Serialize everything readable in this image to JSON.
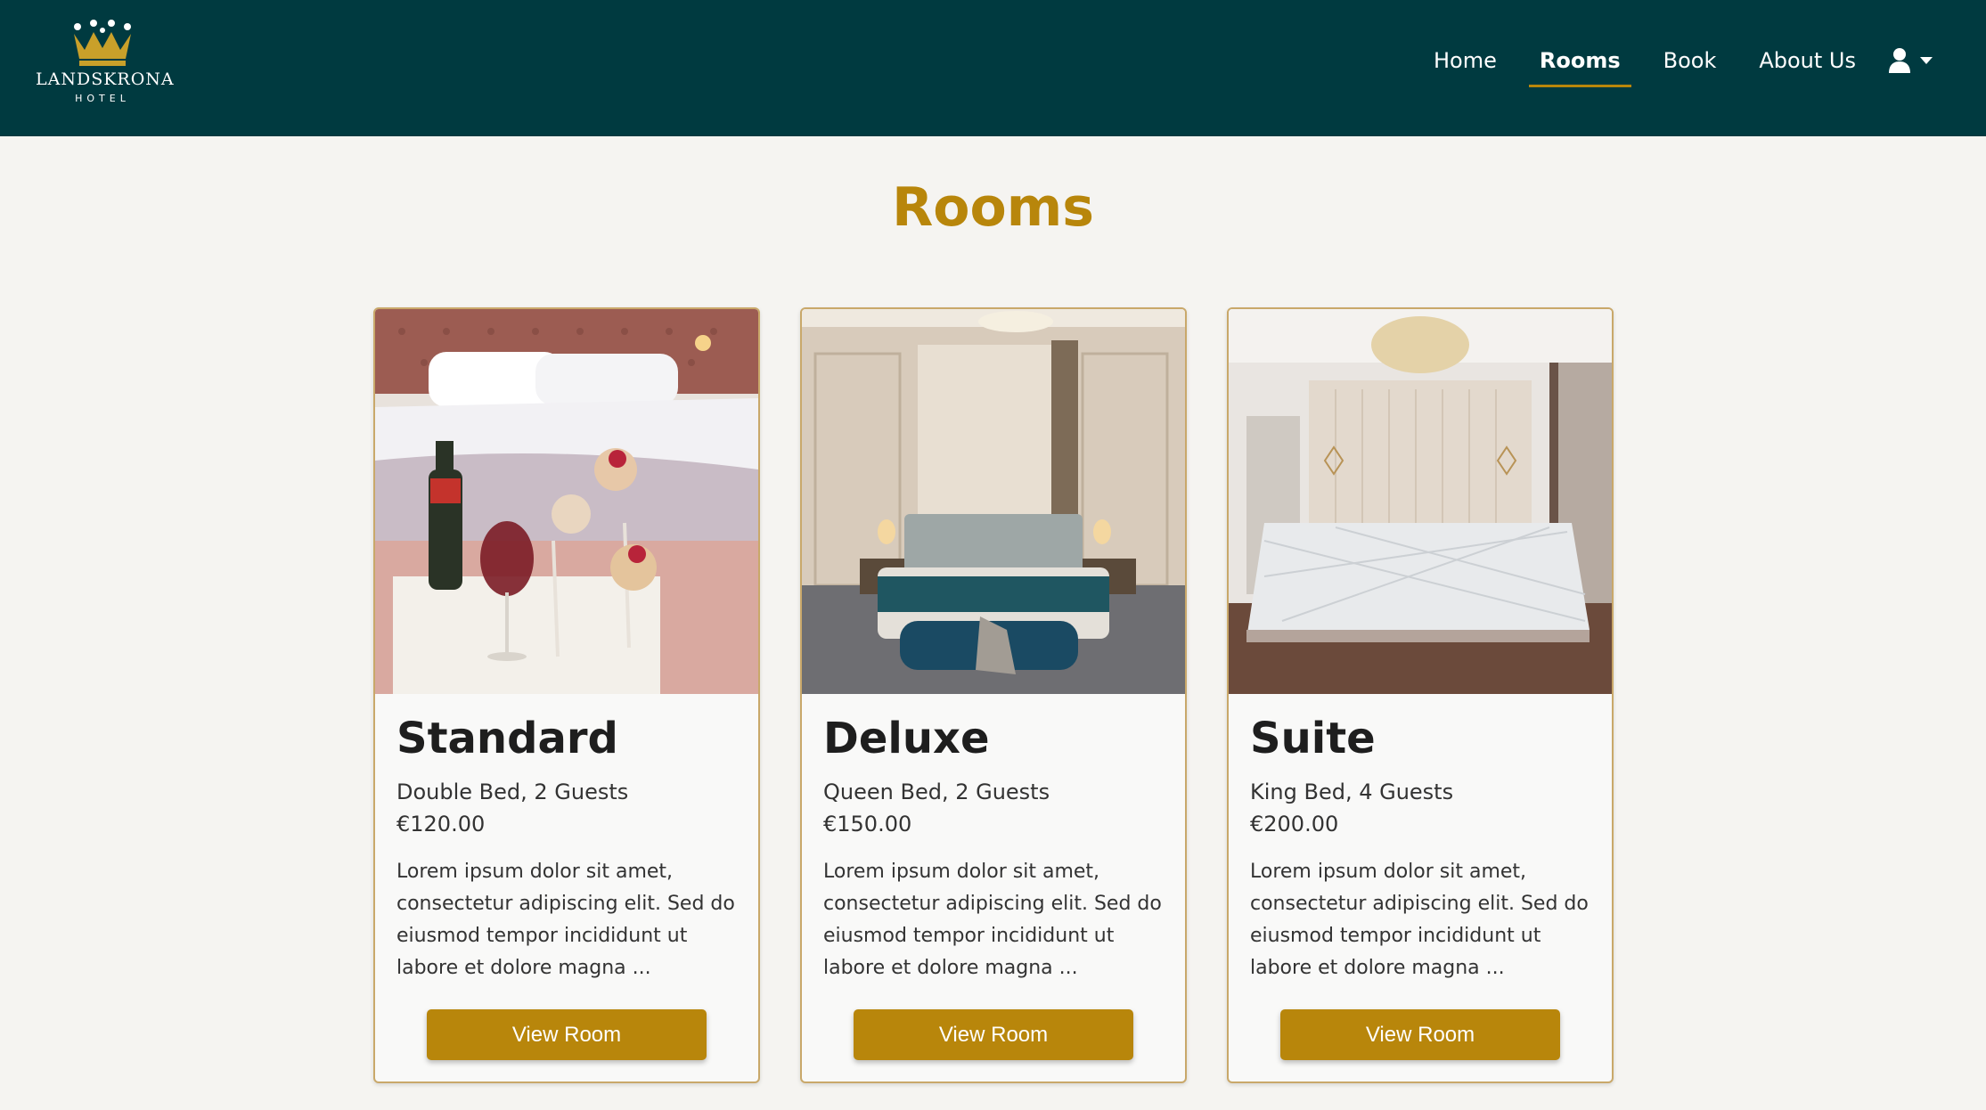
{
  "brand": {
    "name": "LANDSKRONA",
    "sub": "HOTEL"
  },
  "nav": {
    "items": [
      {
        "label": "Home",
        "active": false
      },
      {
        "label": "Rooms",
        "active": true
      },
      {
        "label": "Book",
        "active": false
      },
      {
        "label": "About Us",
        "active": false
      }
    ],
    "user_icon": "user-icon"
  },
  "page": {
    "title": "Rooms"
  },
  "rooms": [
    {
      "name": "Standard",
      "beds": "Double Bed, 2 Guests",
      "price": "€120.00",
      "description": "Lorem ipsum dolor sit amet, consectetur adipiscing elit. Sed do eiusmod tempor incididunt ut labore et dolore magna ...",
      "button": "View Room",
      "image": "standard-room-photo"
    },
    {
      "name": "Deluxe",
      "beds": "Queen Bed, 2 Guests",
      "price": "€150.00",
      "description": "Lorem ipsum dolor sit amet, consectetur adipiscing elit. Sed do eiusmod tempor incididunt ut labore et dolore magna ...",
      "button": "View Room",
      "image": "deluxe-room-photo"
    },
    {
      "name": "Suite",
      "beds": "King Bed, 4 Guests",
      "price": "€200.00",
      "description": "Lorem ipsum dolor sit amet, consectetur adipiscing elit. Sed do eiusmod tempor incididunt ut labore et dolore magna ...",
      "button": "View Room",
      "image": "suite-room-photo"
    }
  ],
  "colors": {
    "navbar": "#003a40",
    "accent": "#b8860b",
    "background": "#f5f4f1"
  }
}
